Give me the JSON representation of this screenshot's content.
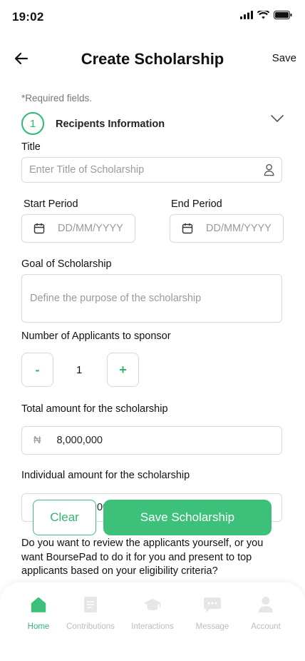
{
  "status": {
    "time": "19:02"
  },
  "header": {
    "title": "Create Scholarship",
    "save_label": "Save"
  },
  "form": {
    "required_note": "*Required fields.",
    "step_number": "1",
    "step_label": "Recipents Information",
    "title_label": "Title",
    "title_placeholder": "Enter Title of Scholarship",
    "start_label": "Start Period",
    "end_label": "End Period",
    "date_placeholder": "DD/MM/YYYY",
    "goal_label": "Goal of Scholarship",
    "goal_placeholder": "Define the purpose of the scholarship",
    "applicants_label": "Number of Applicants to sponsor",
    "applicants_value": "1",
    "minus": "-",
    "plus": "+",
    "total_label": "Total amount for the scholarship",
    "currency": "₦",
    "total_value": "8,000,000",
    "individual_label": "Individual amount for the scholarship",
    "individual_partial": "00",
    "question": "Do you want to review the applicants yourself, or you want BoursePad to do it for you and present to top applicants based on your eligibility criteria?"
  },
  "actions": {
    "clear": "Clear",
    "save": "Save Scholarship"
  },
  "nav": [
    {
      "label": "Home",
      "icon": "home-icon"
    },
    {
      "label": "Contributions",
      "icon": "document-icon"
    },
    {
      "label": "Interactions",
      "icon": "graduation-cap-icon"
    },
    {
      "label": "Message",
      "icon": "message-icon"
    },
    {
      "label": "Account",
      "icon": "user-icon"
    }
  ],
  "colors": {
    "accent": "#3cc07a",
    "muted": "#bcbcbc"
  }
}
